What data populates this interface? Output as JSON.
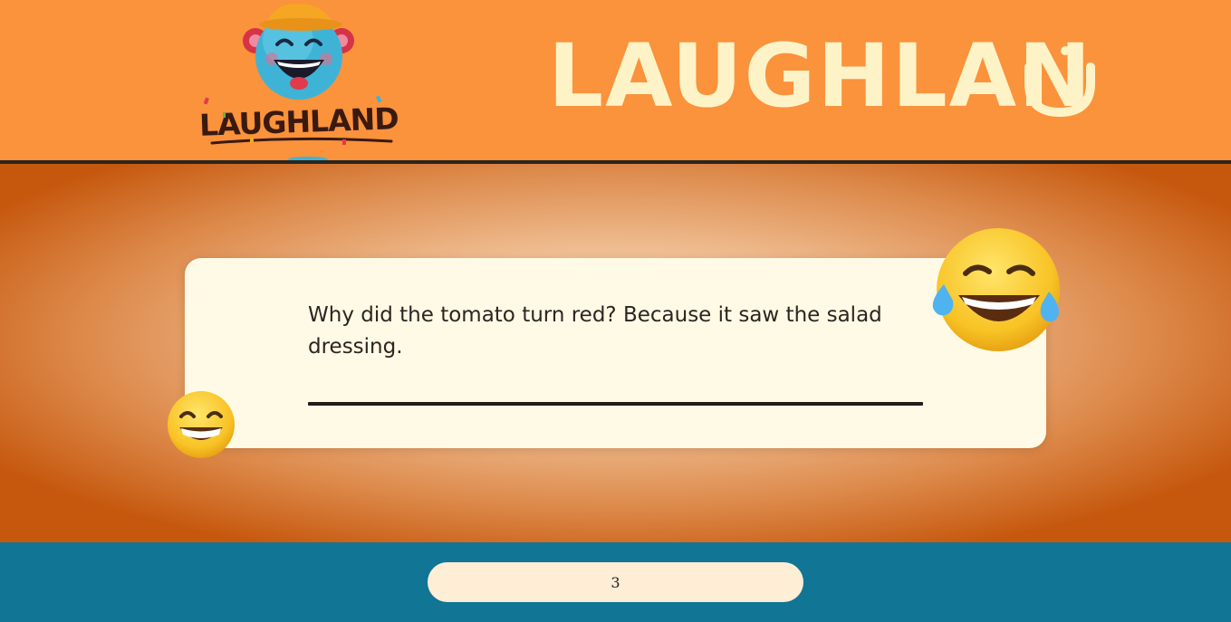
{
  "header": {
    "logo_text": "LAUGHLAND",
    "brand_title": "LAUGHLAN",
    "brand_icon": "smile-o-icon"
  },
  "joke": {
    "text": "Why did the tomato turn red? Because it saw the salad dressing."
  },
  "decorations": {
    "top_right_emoji": "tears-of-joy-icon",
    "bottom_left_emoji": "grinning-icon"
  },
  "footer": {
    "page_number": "3"
  },
  "colors": {
    "header_bg": "#fb923c",
    "brand_text": "#fef3c7",
    "card_bg": "#fefae6",
    "footer_bg": "#117595",
    "pill_bg": "#ffeed6"
  }
}
